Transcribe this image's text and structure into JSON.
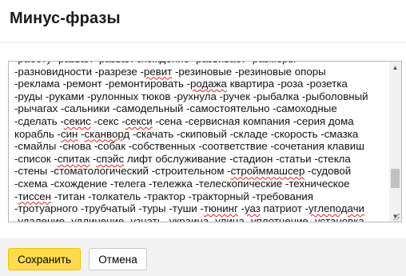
{
  "dialog": {
    "title": "Минус-фразы"
  },
  "textarea": {
    "lines": [
      [
        {
          "t": "-работу -развал -развал схождение -развивает -размеры"
        }
      ],
      [
        {
          "t": "-разновидности -разрезе -"
        },
        {
          "t": "ревит",
          "sp": true
        },
        {
          "t": " -резиновые -резиновые опоры"
        }
      ],
      [
        {
          "t": "-реклама -ремонт -ремонтировать -"
        },
        {
          "t": "родажа",
          "sp": true
        },
        {
          "t": " квартира -роза -розетка"
        }
      ],
      [
        {
          "t": "-руды -руками -рулонных тюков -рухнула -ручек -рыбалка -рыболовный"
        }
      ],
      [
        {
          "t": "-рычагах -сальники -самодельный -самостоятельно -самоходные"
        }
      ],
      [
        {
          "t": "-сделать -"
        },
        {
          "t": "секис",
          "sp": true
        },
        {
          "t": " -секс -"
        },
        {
          "t": "секси",
          "sp": true
        },
        {
          "t": " -сена -сервисная компания -серия дома"
        }
      ],
      [
        {
          "t": "корабль -"
        },
        {
          "t": "син",
          "sp": true
        },
        {
          "t": " -"
        },
        {
          "t": "сканворд",
          "sp": true
        },
        {
          "t": " -скачать -скиповый -складе -скорость -смазка"
        }
      ],
      [
        {
          "t": "-смайлы -снова -собак -собственных -соответствие -сочетания клавиш"
        }
      ],
      [
        {
          "t": "-список -"
        },
        {
          "t": "спитак",
          "sp": true
        },
        {
          "t": " -"
        },
        {
          "t": "спэйс",
          "sp": true
        },
        {
          "t": " лифт обслуживание -стадион -статьи -стекла"
        }
      ],
      [
        {
          "t": "-стены -стоматологический -строительном -"
        },
        {
          "t": "стройммашсер",
          "sp": true
        },
        {
          "t": " -судовой"
        }
      ],
      [
        {
          "t": "-схема -схождение -телега -тележка -телескопические -техническое"
        }
      ],
      [
        {
          "t": "-"
        },
        {
          "t": "тиссен",
          "sp": true
        },
        {
          "t": " -титан -толкатель -трактор -тракторный -требования"
        }
      ],
      [
        {
          "t": "-тротуарного -трубчатый -туры -туши -"
        },
        {
          "t": "тюнинг",
          "sp": true
        },
        {
          "t": " -"
        },
        {
          "t": "уаз",
          "sp": true
        },
        {
          "t": " патриот -"
        },
        {
          "t": "углеподачи",
          "sp": true
        }
      ],
      [
        {
          "t": "-удаление -удлинение -узнать -украина -улица -уплотнение -установка"
        }
      ]
    ]
  },
  "footer": {
    "save_label": "Сохранить",
    "cancel_label": "Отмена"
  },
  "colors": {
    "accent": "#ffdb4d",
    "spellcheck": "#e02020",
    "footer_bg": "#f2f2f2"
  },
  "icons": {
    "scroll_up": "triangle-up-icon",
    "scroll_down": "triangle-down-icon",
    "resize": "resize-grip-icon"
  }
}
